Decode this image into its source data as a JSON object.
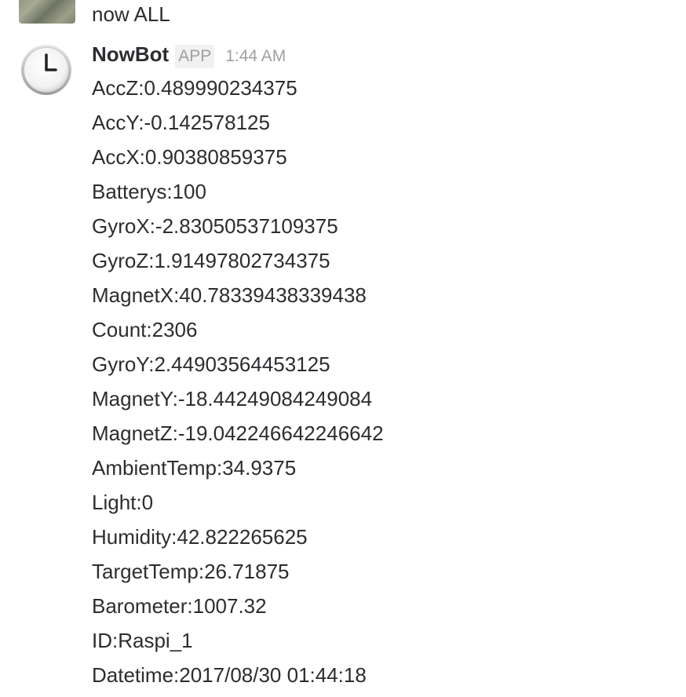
{
  "previous_message": {
    "text": "now ALL"
  },
  "message": {
    "sender": "NowBot",
    "badge": "APP",
    "time": "1:44 AM",
    "avatar_icon": "clock-icon",
    "lines": [
      "AccZ:0.489990234375",
      "AccY:-0.142578125",
      "AccX:0.90380859375",
      "Batterys:100",
      "GyroX:-2.83050537109375",
      "GyroZ:1.91497802734375",
      "MagnetX:40.78339438339438",
      "Count:2306",
      "GyroY:2.44903564453125",
      "MagnetY:-18.44249084249084",
      "MagnetZ:-19.042246642246642",
      "AmbientTemp:34.9375",
      "Light:0",
      "Humidity:42.822265625",
      "TargetTemp:26.71875",
      "Barometer:1007.32",
      "ID:Raspi_1",
      "Datetime:2017/08/30 01:44:18"
    ]
  },
  "colors": {
    "text": "#2c2d30",
    "muted": "#a0a0a2",
    "badge_bg": "#f1f1f1"
  }
}
